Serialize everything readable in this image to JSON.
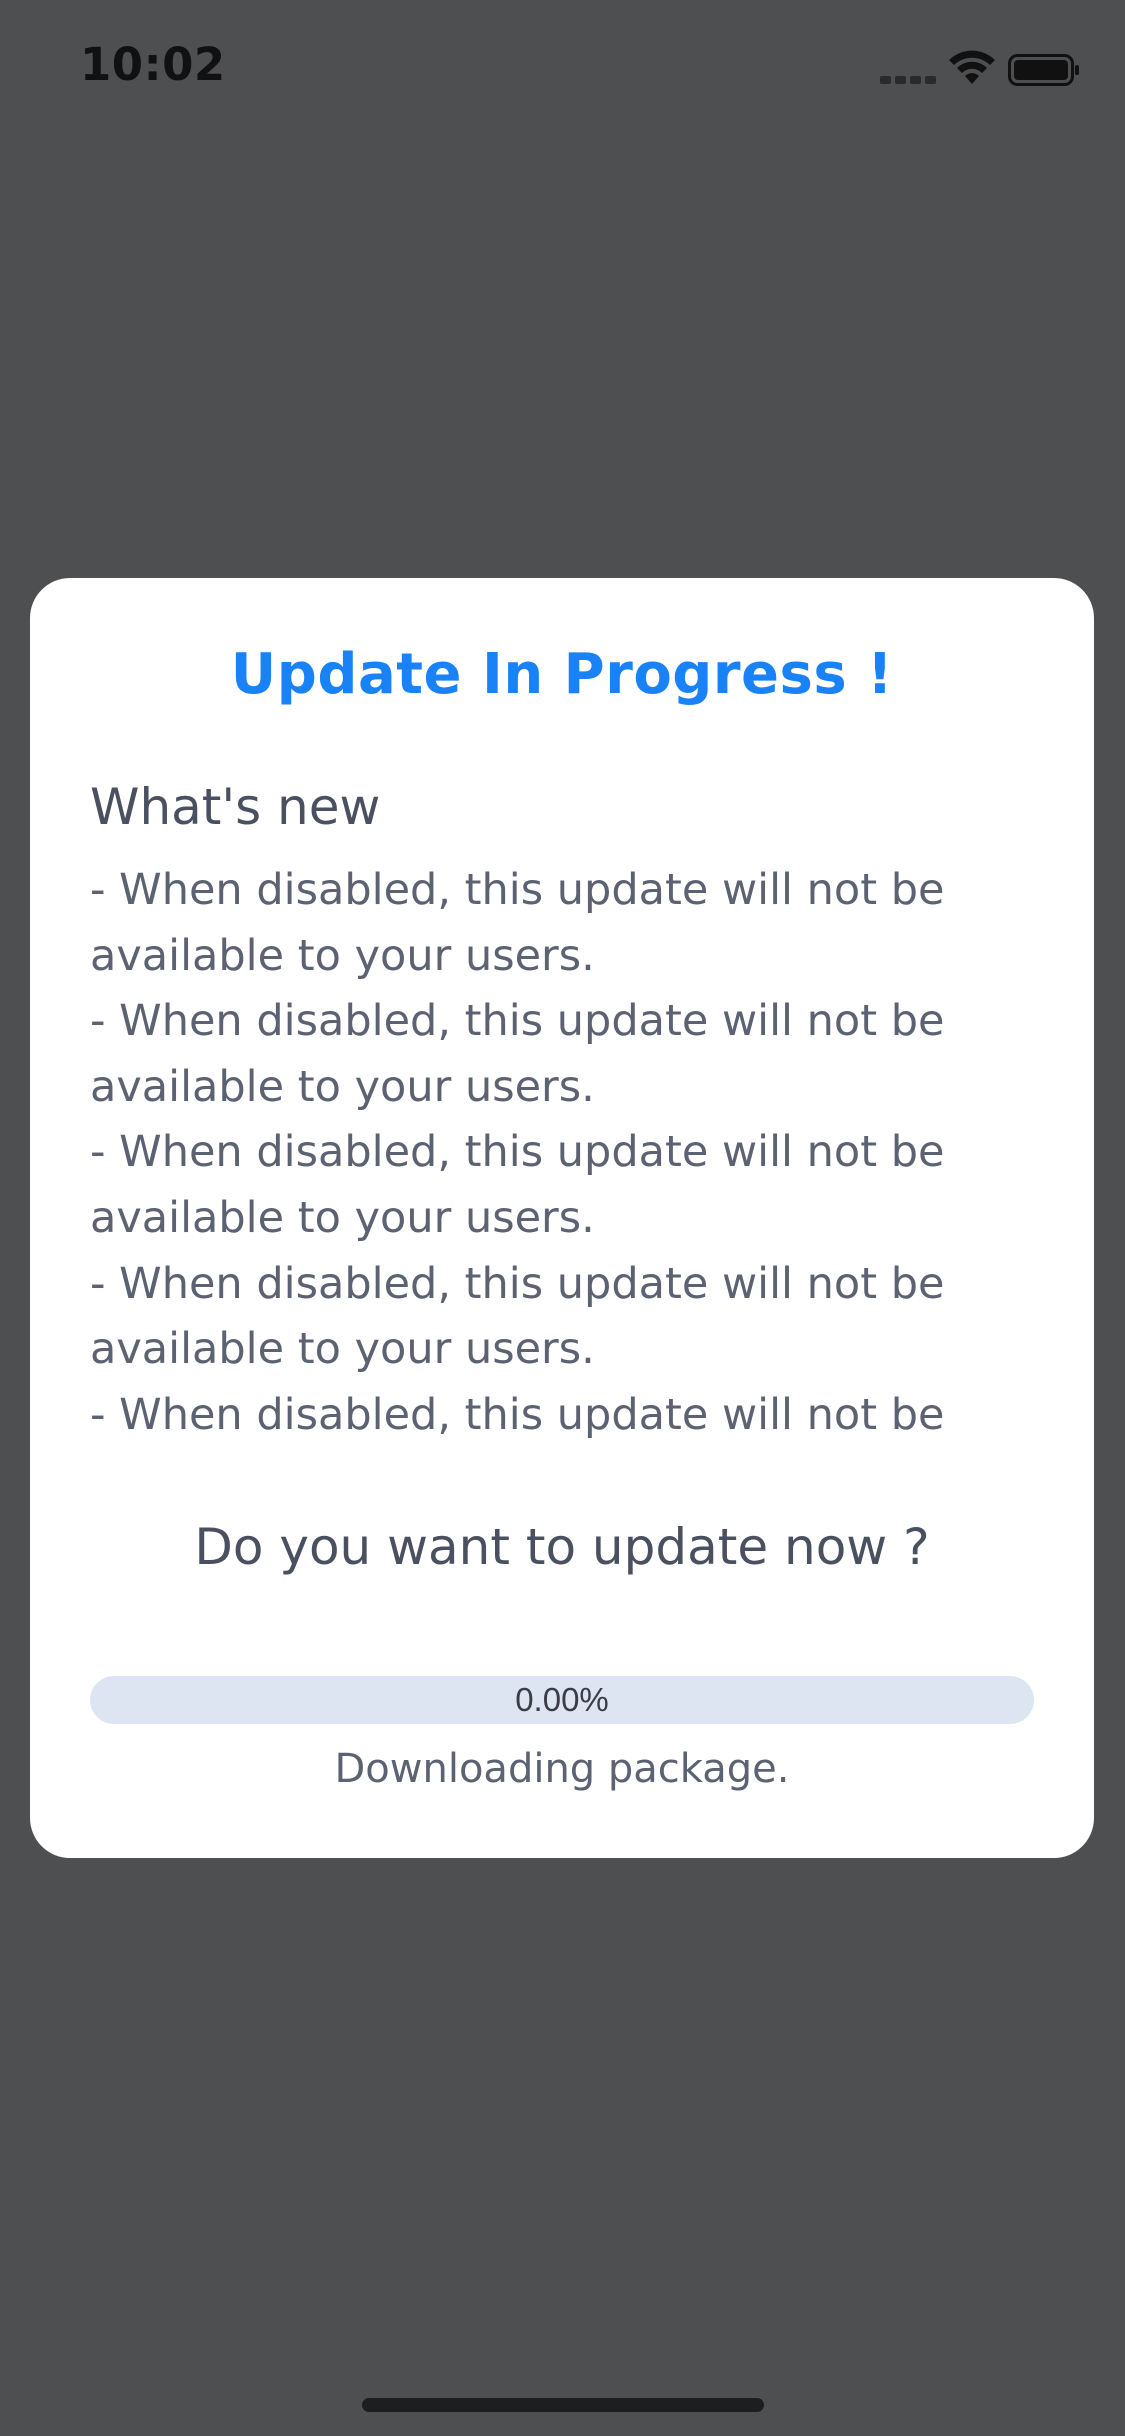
{
  "status_bar": {
    "time": "10:02",
    "icons": [
      "cellular-signal-icon",
      "wifi-icon",
      "battery-icon"
    ]
  },
  "modal": {
    "title": "Update In Progress !",
    "whats_new_heading": "What's new",
    "notes_lines": [
      "- When disabled, this update will not be",
      "available to your users.",
      "- When disabled, this update will not be",
      "available to your users.",
      "- When disabled, this update will not be",
      "available to your users.",
      "- When disabled, this update will not be",
      "available to your users.",
      "- When disabled, this update will not be"
    ],
    "question": "Do you want to update now ?",
    "progress": {
      "percent_label": "0.00%",
      "value": 0
    },
    "status_text": "Downloading package."
  },
  "colors": {
    "accent": "#1a82f7",
    "backdrop": "#4e4f51",
    "progress_track": "#dde5f2",
    "text_primary": "#4a5060",
    "text_secondary": "#5c6272"
  }
}
